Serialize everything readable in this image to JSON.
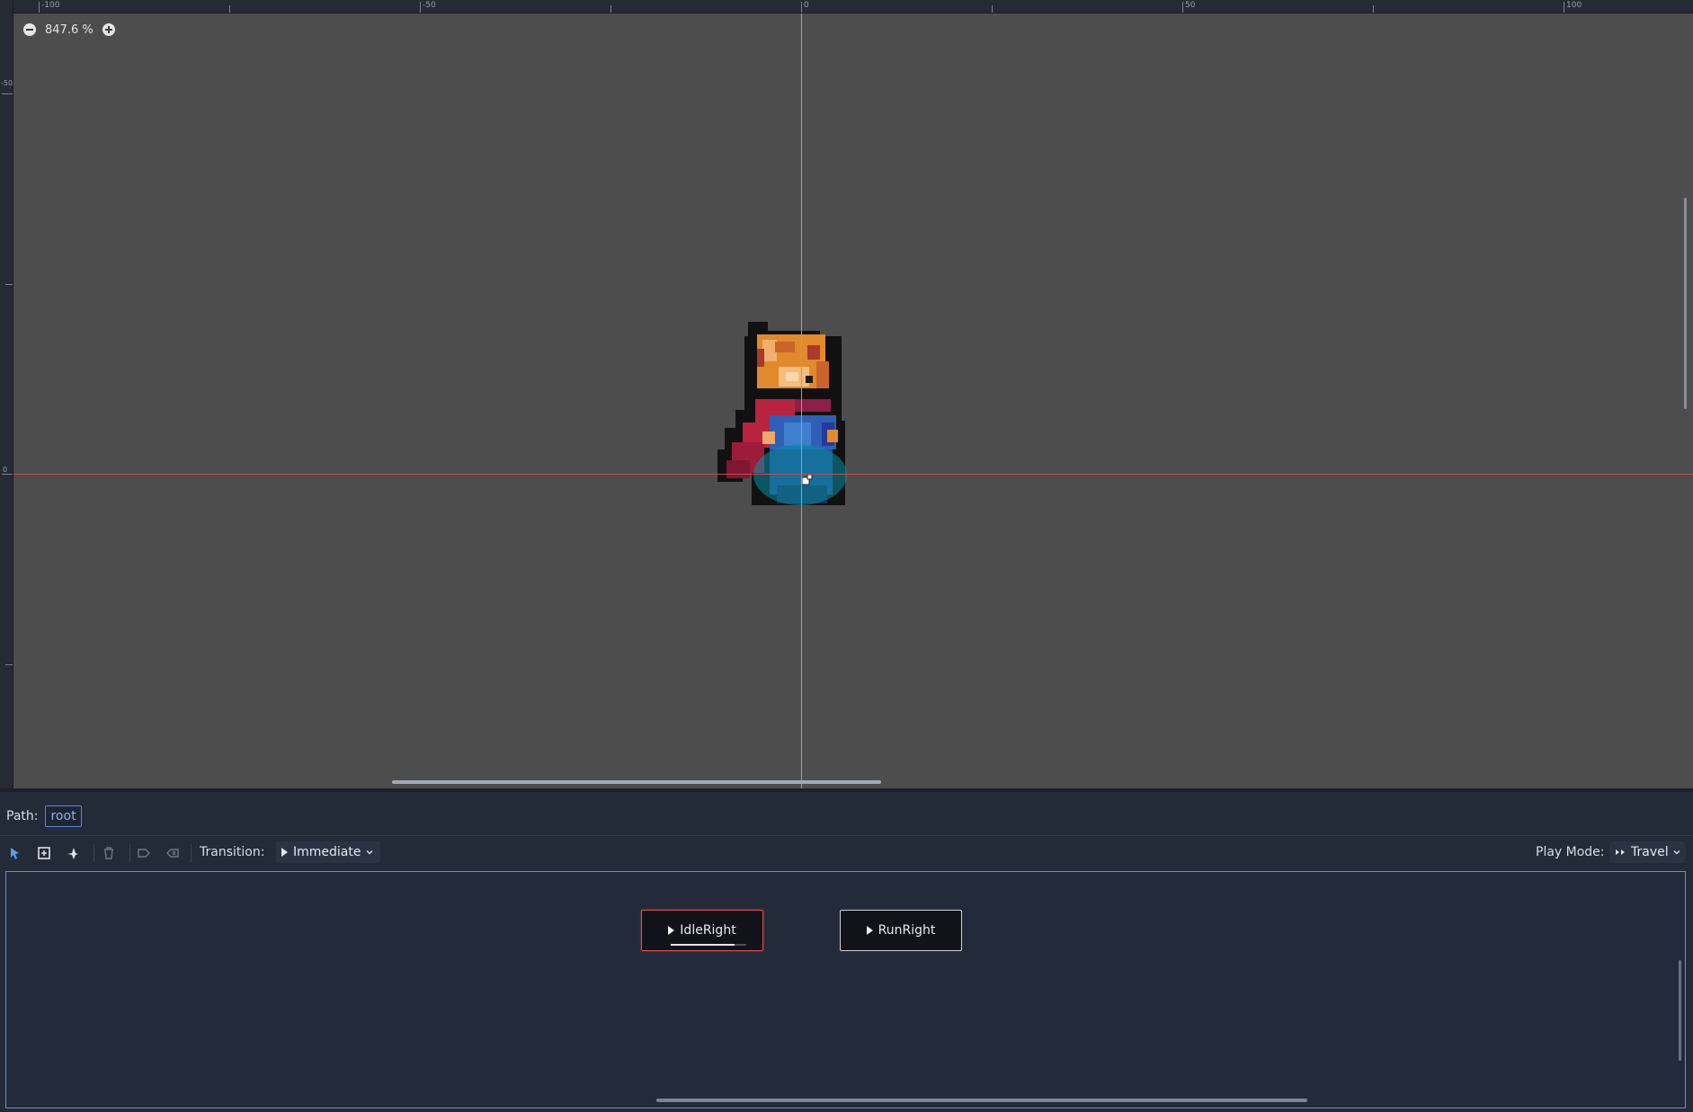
{
  "viewport": {
    "zoom_level": "847.6 %",
    "ruler_top_labels": [
      "-100",
      "-50",
      "0",
      "50",
      "100"
    ],
    "ruler_left_labels": [
      "-50",
      "0"
    ],
    "icons": {
      "zoom_out": "zoom-out-icon",
      "zoom_in": "zoom-in-icon"
    }
  },
  "panel": {
    "path_label": "Path:",
    "path_value": "root",
    "transition_label": "Transition:",
    "transition_value": "Immediate",
    "play_mode_label": "Play Mode:",
    "play_mode_value": "Travel",
    "tools": [
      "select-icon",
      "create-node-icon",
      "connect-icon",
      "delete-icon",
      "set-start-icon",
      "set-end-icon"
    ],
    "nodes": [
      {
        "label": "IdleRight",
        "playing": true,
        "progress": 0.85
      },
      {
        "label": "RunRight",
        "playing": false
      }
    ]
  },
  "colors": {
    "accent": "#5b86d6",
    "active_node_border": "#e0504d",
    "axis_x": "#c5494f",
    "axis_y": "#7dc63a"
  }
}
